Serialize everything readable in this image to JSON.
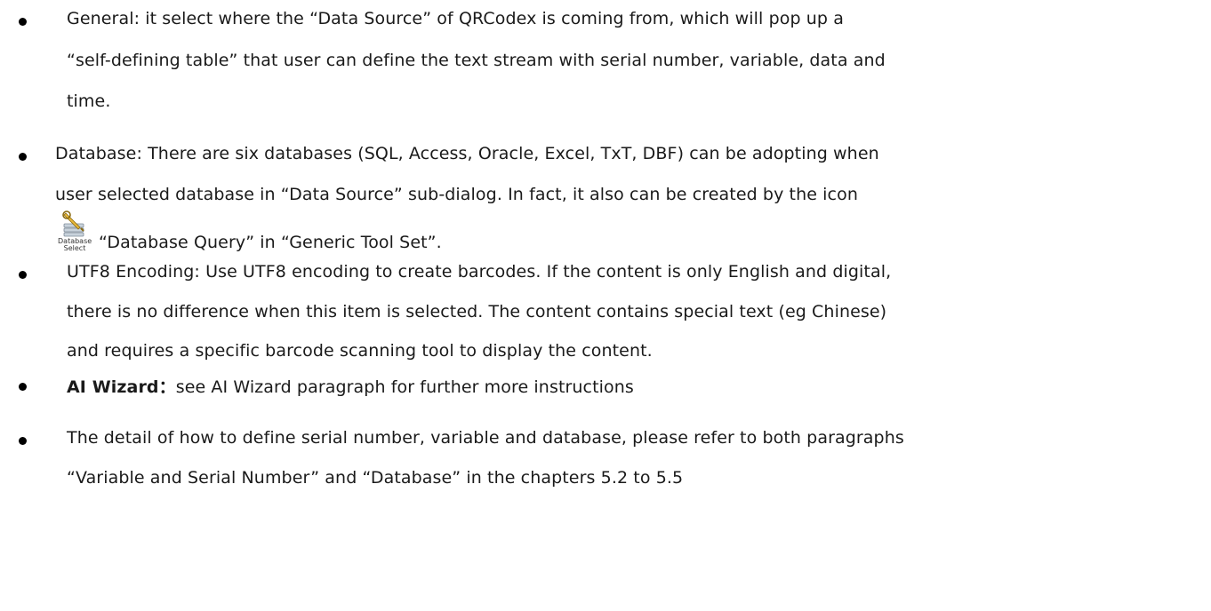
{
  "items": [
    {
      "lines": [
        "General: it select where the “Data Source” of QRCodex is coming from, which will pop up a",
        "“self-defining table” that user can define the text stream with serial number, variable, data and",
        "time."
      ]
    },
    {
      "lines": [
        "Database: There are six databases (SQL, Access, Oracle, Excel, TxT, DBF) can be adopting when",
        "user selected database in “Data Source” sub-dialog. In fact, it also can be created by the icon"
      ],
      "icon": {
        "name": "database-select-icon",
        "caption_top": "Database",
        "caption_bottom": "Select"
      },
      "after_icon": "“Database Query” in “Generic Tool Set”."
    },
    {
      "lines": [
        "UTF8 Encoding: Use UTF8 encoding to create barcodes. If the content is only English and digital,",
        "there is no difference when this item is selected. The content contains special text (eg Chinese)",
        "and requires a specific barcode scanning tool to display the content."
      ]
    },
    {
      "bold_label": "AI Wizard：",
      "text": "see AI Wizard paragraph for further more instructions"
    },
    {
      "lines": [
        "The detail of how to define serial number, variable and database, please refer to both paragraphs",
        "“Variable and Serial Number” and “Database” in the chapters 5.2 to 5.5"
      ]
    }
  ]
}
